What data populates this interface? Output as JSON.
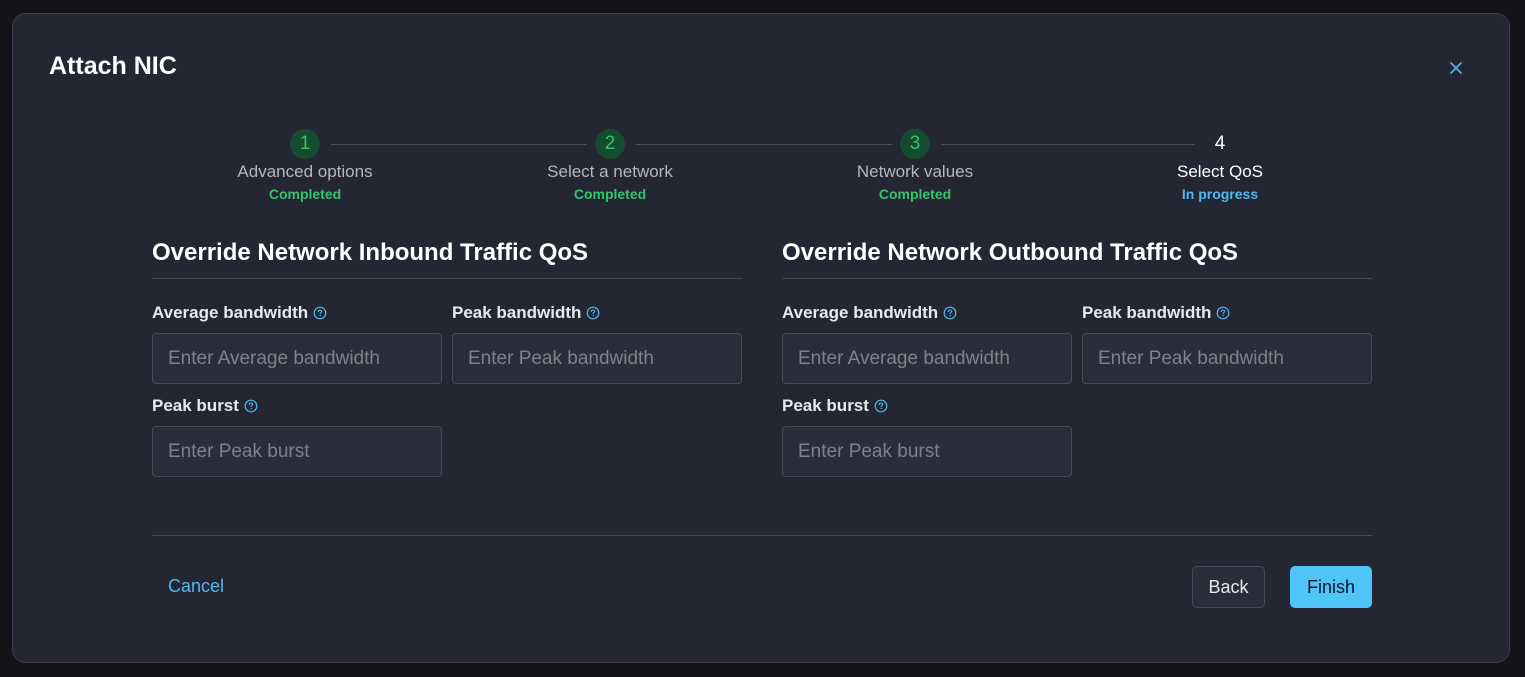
{
  "dialog": {
    "title": "Attach NIC"
  },
  "steps": [
    {
      "number": "1",
      "label": "Advanced options",
      "status": "Completed"
    },
    {
      "number": "2",
      "label": "Select a network",
      "status": "Completed"
    },
    {
      "number": "3",
      "label": "Network values",
      "status": "Completed"
    },
    {
      "number": "4",
      "label": "Select QoS",
      "status": "In progress"
    }
  ],
  "inbound": {
    "heading": "Override Network Inbound Traffic QoS",
    "average_label": "Average bandwidth",
    "average_placeholder": "Enter Average bandwidth",
    "peak_label": "Peak bandwidth",
    "peak_placeholder": "Enter Peak bandwidth",
    "burst_label": "Peak burst",
    "burst_placeholder": "Enter Peak burst"
  },
  "outbound": {
    "heading": "Override Network Outbound Traffic QoS",
    "average_label": "Average bandwidth",
    "average_placeholder": "Enter Average bandwidth",
    "peak_label": "Peak bandwidth",
    "peak_placeholder": "Enter Peak bandwidth",
    "burst_label": "Peak burst",
    "burst_placeholder": "Enter Peak burst"
  },
  "footer": {
    "cancel_label": "Cancel",
    "back_label": "Back",
    "finish_label": "Finish"
  },
  "colors": {
    "completed": "#34c56b",
    "in_progress": "#4fb8f0",
    "primary": "#4fc4f7"
  },
  "icons": {
    "close": "close-icon",
    "help": "help-circle-icon"
  }
}
